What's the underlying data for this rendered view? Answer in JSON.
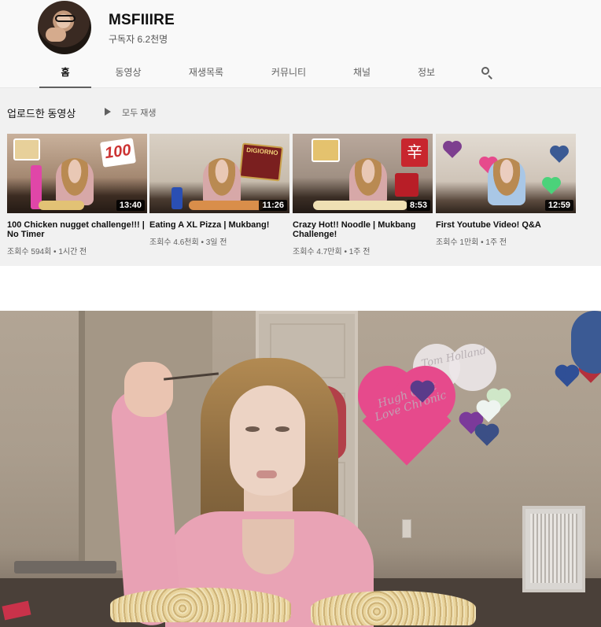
{
  "channel": {
    "name": "MSFIIIRE",
    "subscribers": "구독자 6.2천명"
  },
  "tabs": [
    {
      "label": "홈",
      "active": true
    },
    {
      "label": "동영상",
      "active": false
    },
    {
      "label": "재생목록",
      "active": false
    },
    {
      "label": "커뮤니티",
      "active": false
    },
    {
      "label": "채널",
      "active": false
    },
    {
      "label": "정보",
      "active": false
    }
  ],
  "search_icon": "search-icon",
  "shelf": {
    "title": "업로드한 동영상",
    "play_all": "모두 재생",
    "play_icon": "play-icon"
  },
  "videos": [
    {
      "title": "100 Chicken nugget challenge!!! | No Timer",
      "duration": "13:40",
      "meta": "조회수 594회 • 1시간 전"
    },
    {
      "title": "Eating A XL Pizza | Mukbang!",
      "duration": "11:26",
      "meta": "조회수 4.6천회 • 3일 전"
    },
    {
      "title": "Crazy Hot!! Noodle | Mukbang Challenge!",
      "duration": "8:53",
      "meta": "조회수 4.7만회 • 1주 전"
    },
    {
      "title": "First Youtube Video! Q&A",
      "duration": "12:59",
      "meta": "조회수 1만회 • 1주 전"
    }
  ],
  "thumb_text": {
    "t1": "100",
    "t2": "DIGIORNO",
    "t3": "辛"
  },
  "still": {
    "heart_text_white": "Tom Holland",
    "heart_text_pink": "Hugh Chat Love Chronic"
  },
  "colors": {
    "panel_bg": "#f9f9f9",
    "shelf_bg": "#f1f1f1",
    "wall_pink_heart": "#e64a8c",
    "sweater": "#e9a3b5"
  }
}
